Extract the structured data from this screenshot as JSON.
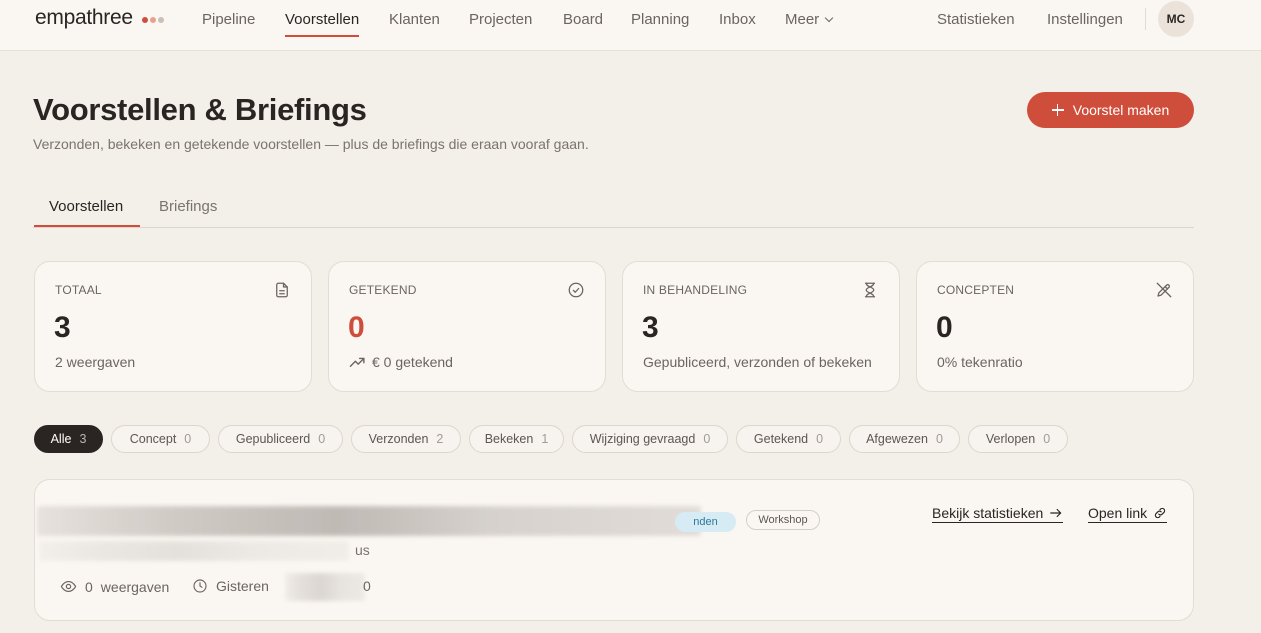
{
  "brand": {
    "name": "empathree",
    "dot_colors": [
      "#cf4e3b",
      "#e7a28f",
      "#c9bfb5"
    ]
  },
  "nav": {
    "items": [
      "Pipeline",
      "Voorstellen",
      "Klanten",
      "Projecten",
      "Board",
      "Planning",
      "Inbox",
      "Meer"
    ],
    "active": "Voorstellen",
    "right_items": [
      "Statistieken",
      "Instellingen"
    ],
    "avatar_initials": "MC"
  },
  "header": {
    "title": "Voorstellen & Briefings",
    "subtitle": "Verzonden, bekeken en getekende voorstellen — plus de briefings die eraan vooraf gaan.",
    "primary_button": "Voorstel maken"
  },
  "tabs": [
    {
      "label": "Voorstellen",
      "active": true
    },
    {
      "label": "Briefings",
      "active": false
    }
  ],
  "stats": [
    {
      "label": "TOTAAL",
      "value": "3",
      "footer": "2 weergaven",
      "icon": "document-icon"
    },
    {
      "label": "GETEKEND",
      "value": "0",
      "footer": "€ 0 getekend",
      "icon": "check-circle-icon",
      "footer_icon": "trend-up-icon"
    },
    {
      "label": "IN BEHANDELING",
      "value": "3",
      "footer": "Gepubliceerd, verzonden of bekeken",
      "icon": "hourglass-icon"
    },
    {
      "label": "CONCEPTEN",
      "value": "0",
      "footer": "0% tekenratio",
      "icon": "pencil-off-icon"
    }
  ],
  "filters": [
    {
      "label": "Alle",
      "count": "3",
      "active": true
    },
    {
      "label": "Concept",
      "count": "0"
    },
    {
      "label": "Gepubliceerd",
      "count": "0"
    },
    {
      "label": "Verzonden",
      "count": "2"
    },
    {
      "label": "Bekeken",
      "count": "1"
    },
    {
      "label": "Wijziging gevraagd",
      "count": "0"
    },
    {
      "label": "Getekend",
      "count": "0"
    },
    {
      "label": "Afgewezen",
      "count": "0"
    },
    {
      "label": "Verlopen",
      "count": "0"
    }
  ],
  "proposal": {
    "status_badge": "nden",
    "tag": "Workshop",
    "subtitle_fragment": "us",
    "views_count": "0",
    "views_label": "weergaven",
    "date": "Gisteren",
    "amount_fragment": "0",
    "link_stats": "Bekijk statistieken",
    "link_open": "Open link"
  },
  "colors": {
    "accent": "#cf4e3b",
    "background": "#f3efe9",
    "card": "#faf7f2",
    "badge_blue": "#d6ebf3"
  }
}
